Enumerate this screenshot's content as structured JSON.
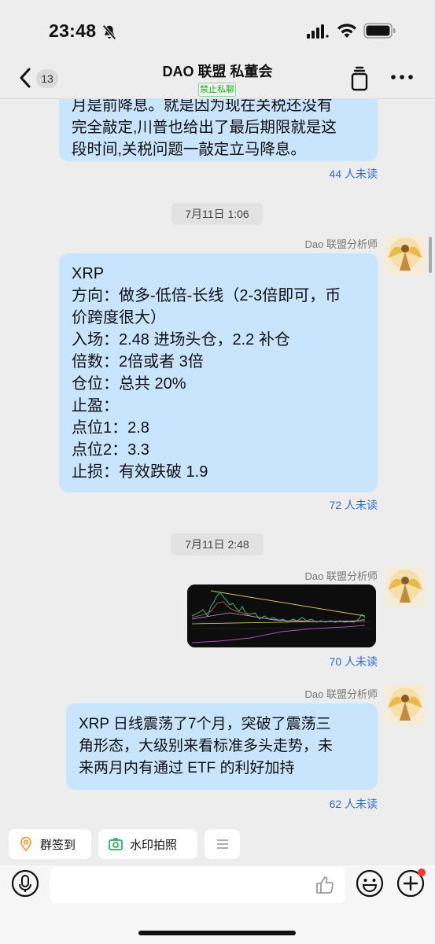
{
  "status_bar": {
    "time": "23:48"
  },
  "header": {
    "back_unread_count": "13",
    "title": "DAO 联盟 私董会",
    "badge": "禁止私聊"
  },
  "messages": [
    {
      "text": "月是前降息。就是因为现在关税还没有\n完全敲定,川普也给出了最后期限就是这\n段时间,关税问题一敲定立马降息。",
      "read_receipt": "44 人未读"
    },
    {
      "time_divider": "7月11日 1:06",
      "sender": "Dao 联盟分析师",
      "text": "XRP\n方向：做多-低倍-长线（2-3倍即可，币\n价跨度很大）\n入场：2.48 进场头仓，2.2 补仓\n倍数：2倍或者 3倍\n仓位：总共 20%\n止盈：\n点位1：2.8\n点位2：3.3\n止损：有效跌破 1.9",
      "read_receipt": "72 人未读"
    },
    {
      "time_divider": "7月11日 2:48",
      "sender": "Dao 联盟分析师",
      "image": "XRP chart screenshot",
      "read_receipt": "70 人未读"
    },
    {
      "sender": "Dao 联盟分析师",
      "text": "XRP 日线震荡了7个月，突破了震荡三\n角形态，大级别来看标准多头走势，未\n来两月内有通过 ETF 的利好加持",
      "read_receipt": "62 人未读"
    }
  ],
  "quick_actions": [
    {
      "label": "群签到",
      "icon": "location-pin-icon"
    },
    {
      "label": "水印拍照",
      "icon": "camera-icon"
    },
    {
      "icon": "menu-lines-icon"
    }
  ],
  "input_bar": {
    "placeholder": ""
  },
  "colors": {
    "background": "#ededed",
    "bubble": "#c9e4fd",
    "read_receipt": "#2b6cd0",
    "badge_green": "#1aad19",
    "notify_red": "#f43530"
  }
}
